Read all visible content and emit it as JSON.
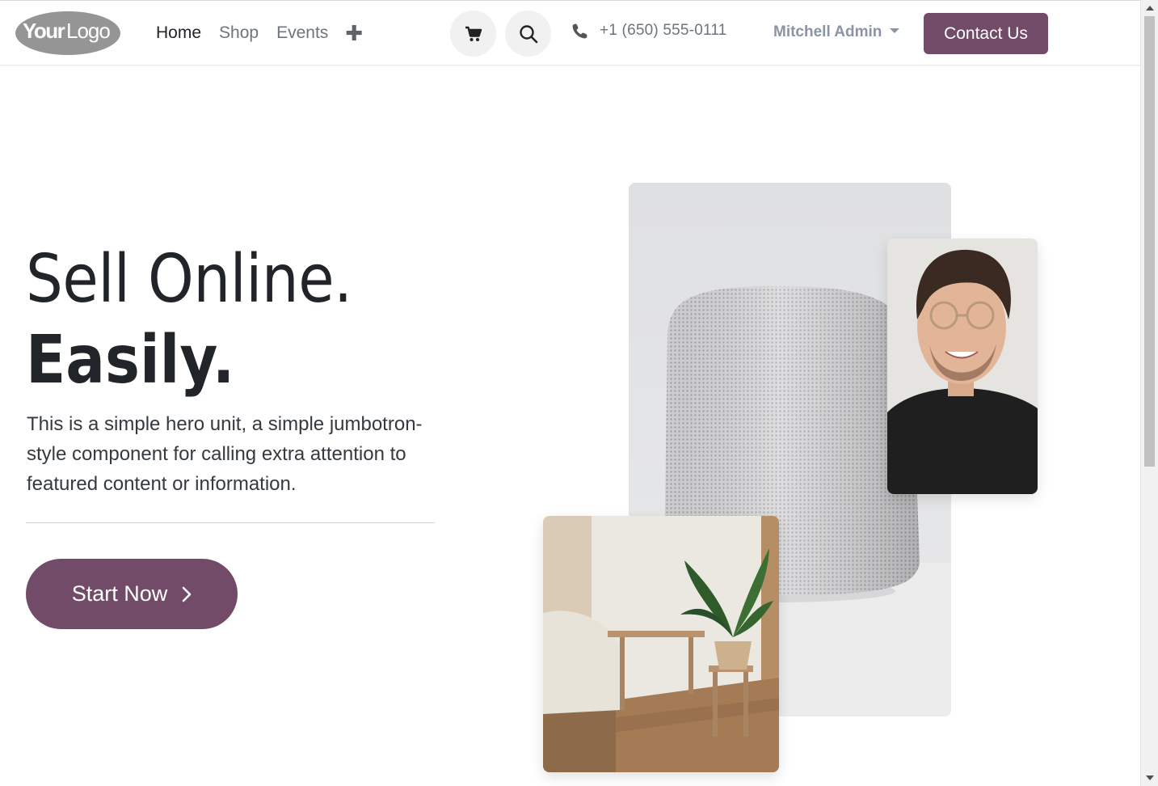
{
  "header": {
    "logo_text": "YourLogo",
    "nav": [
      {
        "label": "Home",
        "active": true
      },
      {
        "label": "Shop",
        "active": false
      },
      {
        "label": "Events",
        "active": false
      }
    ],
    "add_icon": "plus-icon",
    "cart_icon": "cart-icon",
    "search_icon": "search-icon",
    "phone_icon": "phone-icon",
    "phone": "+1 (650) 555-0111",
    "user": "Mitchell Admin",
    "contact_button": "Contact Us"
  },
  "hero": {
    "title_line1": "Sell Online.",
    "title_line2": "Easily.",
    "text": "This is a simple hero unit, a simple jumbotron-style component for calling extra attention to featured content or information.",
    "cta_label": "Start Now",
    "cta_icon": "chevron-right-icon"
  },
  "colors": {
    "brand": "#714b67",
    "text": "#212529",
    "muted": "#6c757d"
  }
}
